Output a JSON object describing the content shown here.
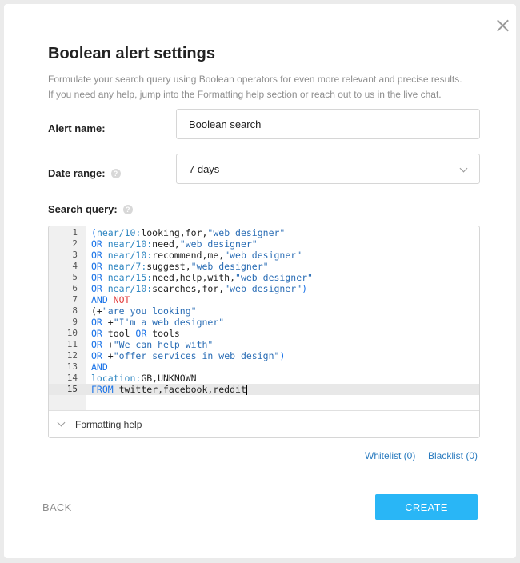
{
  "dialog": {
    "title": "Boolean alert settings",
    "description_line1": "Formulate your search query using Boolean operators for even more relevant and precise results.",
    "description_line2": "If you need any help, jump into the Formatting help section or reach out to us in the live chat."
  },
  "form": {
    "alert_name_label": "Alert name:",
    "alert_name_value": "Boolean search",
    "date_range_label": "Date range:",
    "date_range_value": "7 days",
    "search_query_label": "Search query:",
    "help_glyph": "?"
  },
  "editor": {
    "lines": [
      {
        "n": "1",
        "tokens": [
          {
            "t": "(",
            "c": "kw"
          },
          {
            "t": "near/10:",
            "c": "op"
          },
          {
            "t": "looking,for,",
            "c": ""
          },
          {
            "t": "\"web designer\"",
            "c": "str"
          }
        ]
      },
      {
        "n": "2",
        "tokens": [
          {
            "t": "OR ",
            "c": "kw"
          },
          {
            "t": "near/10:",
            "c": "op"
          },
          {
            "t": "need,",
            "c": ""
          },
          {
            "t": "\"web designer\"",
            "c": "str"
          }
        ]
      },
      {
        "n": "3",
        "tokens": [
          {
            "t": "OR ",
            "c": "kw"
          },
          {
            "t": "near/10:",
            "c": "op"
          },
          {
            "t": "recommend,me,",
            "c": ""
          },
          {
            "t": "\"web designer\"",
            "c": "str"
          }
        ]
      },
      {
        "n": "4",
        "tokens": [
          {
            "t": "OR ",
            "c": "kw"
          },
          {
            "t": "near/7:",
            "c": "op"
          },
          {
            "t": "suggest,",
            "c": ""
          },
          {
            "t": "\"web designer\"",
            "c": "str"
          }
        ]
      },
      {
        "n": "5",
        "tokens": [
          {
            "t": "OR ",
            "c": "kw"
          },
          {
            "t": "near/15:",
            "c": "op"
          },
          {
            "t": "need,help,with,",
            "c": ""
          },
          {
            "t": "\"web designer\"",
            "c": "str"
          }
        ]
      },
      {
        "n": "6",
        "tokens": [
          {
            "t": "OR ",
            "c": "kw"
          },
          {
            "t": "near/10:",
            "c": "op"
          },
          {
            "t": "searches,for,",
            "c": ""
          },
          {
            "t": "\"web designer\"",
            "c": "str"
          },
          {
            "t": ")",
            "c": "kw"
          }
        ]
      },
      {
        "n": "7",
        "tokens": [
          {
            "t": "AND ",
            "c": "kw"
          },
          {
            "t": "NOT",
            "c": "not"
          }
        ]
      },
      {
        "n": "8",
        "tokens": [
          {
            "t": "(+",
            "c": ""
          },
          {
            "t": "\"are you looking\"",
            "c": "str"
          }
        ]
      },
      {
        "n": "9",
        "tokens": [
          {
            "t": "OR ",
            "c": "kw"
          },
          {
            "t": "+",
            "c": ""
          },
          {
            "t": "\"I'm a web designer\"",
            "c": "str"
          }
        ]
      },
      {
        "n": "10",
        "tokens": [
          {
            "t": "OR ",
            "c": "kw"
          },
          {
            "t": "tool ",
            "c": ""
          },
          {
            "t": "OR ",
            "c": "kw"
          },
          {
            "t": "tools",
            "c": ""
          }
        ]
      },
      {
        "n": "11",
        "tokens": [
          {
            "t": "OR ",
            "c": "kw"
          },
          {
            "t": "+",
            "c": ""
          },
          {
            "t": "\"We can help with\"",
            "c": "str"
          }
        ]
      },
      {
        "n": "12",
        "tokens": [
          {
            "t": "OR ",
            "c": "kw"
          },
          {
            "t": "+",
            "c": ""
          },
          {
            "t": "\"offer services in web design\"",
            "c": "str"
          },
          {
            "t": ")",
            "c": "kw"
          }
        ]
      },
      {
        "n": "13",
        "tokens": [
          {
            "t": "AND",
            "c": "kw"
          }
        ]
      },
      {
        "n": "14",
        "tokens": [
          {
            "t": "location:",
            "c": "op"
          },
          {
            "t": "GB,UNKNOWN",
            "c": ""
          }
        ]
      },
      {
        "n": "15",
        "tokens": [
          {
            "t": "FROM ",
            "c": "kw"
          },
          {
            "t": "twitter,facebook,reddit",
            "c": ""
          }
        ]
      }
    ],
    "active_line": "15",
    "formatting_help_label": "Formatting help"
  },
  "links": {
    "whitelist": "Whitelist (0)",
    "blacklist": "Blacklist (0)"
  },
  "footer": {
    "back_label": "BACK",
    "create_label": "CREATE"
  },
  "colors": {
    "accent": "#29b6f6",
    "link": "#2a7bbf",
    "keyword": "#1a73e8",
    "not_keyword": "#e23b3b"
  },
  "icons": {
    "close": "close-icon",
    "help": "help-circle-icon",
    "dropdown": "chevron-down-icon",
    "expand": "chevron-down-icon"
  }
}
